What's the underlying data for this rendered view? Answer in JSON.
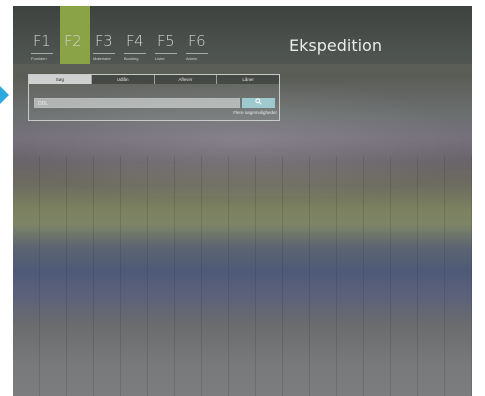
{
  "header": {
    "title": "Ekspedition",
    "fkeys": [
      {
        "key": "F1",
        "label": "Forsiden"
      },
      {
        "key": "F2",
        "label": ""
      },
      {
        "key": "F3",
        "label": "Materialer"
      },
      {
        "key": "F4",
        "label": "Booking"
      },
      {
        "key": "F5",
        "label": "Lister"
      },
      {
        "key": "F6",
        "label": "Admin"
      }
    ],
    "active_color": "#8aa347"
  },
  "panel": {
    "tabs": [
      "Søg",
      "Udlån",
      "Aflever",
      "Låner"
    ],
    "search": {
      "value": "DDL",
      "button_icon": "search-icon"
    },
    "more_link": "Flere søgemuligheder"
  },
  "colors": {
    "accent": "#2ea9e0",
    "search_button": "#9ec9cf"
  }
}
